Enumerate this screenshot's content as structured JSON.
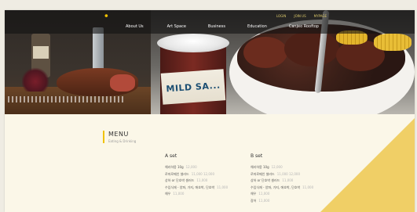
{
  "nav": {
    "home_icon": "home-icon",
    "utility_links": [
      "LOGIN",
      "JOIN US",
      "MYPAGE"
    ],
    "items": [
      "About Us",
      "Art Space",
      "Business",
      "Education",
      "Canjeo Rooftop"
    ]
  },
  "hero": {
    "jar_label": "MILD SA..."
  },
  "menu": {
    "title": "MENU",
    "subtitle": "Eating & Drinking",
    "sets": [
      {
        "title": "A set",
        "items": [
          {
            "name": "해리하몽 10g",
            "price": "12,000"
          },
          {
            "name": "로마로메인 샐러드",
            "price": "11,000 12,000"
          },
          {
            "name": "상하 or 단호박 샐러드",
            "price": "11,000"
          },
          {
            "name": "수입식재 - 양파, 가지, 애호박, 단호박",
            "price": "11,000"
          },
          {
            "name": "해우",
            "price": "11,000"
          }
        ]
      },
      {
        "title": "B set",
        "items": [
          {
            "name": "해리하몽 10g",
            "price": "12,000"
          },
          {
            "name": "로마로메인 샐러드",
            "price": "11,000 12,000"
          },
          {
            "name": "상하 or 단호박 샐러드",
            "price": "11,000"
          },
          {
            "name": "수입식재 - 양파, 가지, 애호박, 단호박",
            "price": "11,000"
          },
          {
            "name": "해우",
            "price": "11,000"
          },
          {
            "name": "장어",
            "price": "11,000"
          }
        ]
      }
    ]
  },
  "colors": {
    "accent_yellow": "#f0c200",
    "corner_yellow": "#f0cf66",
    "page_background": "#fbf7e8"
  }
}
